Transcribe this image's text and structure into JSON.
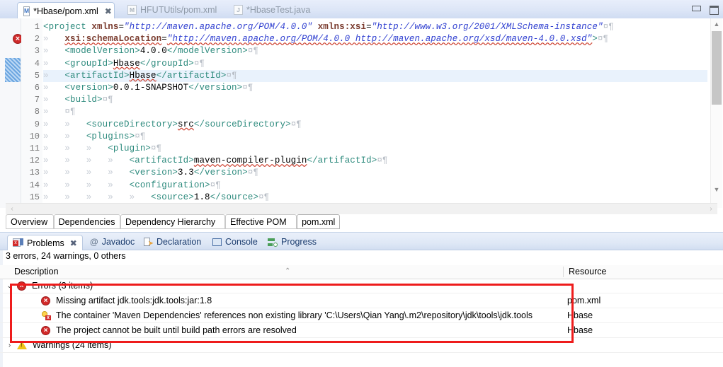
{
  "window": {
    "minimize_label": "Minimize",
    "maximize_label": "Maximize"
  },
  "editor_tabs": [
    {
      "label": "*Hbase/pom.xml",
      "icon": "maven-pom-file-icon",
      "icon_letter": "M",
      "active": true,
      "closeable": true,
      "close_glyph": "✖"
    },
    {
      "label": "HFUTUtils/pom.xml",
      "icon": "maven-pom-file-icon",
      "icon_letter": "M",
      "active": false,
      "closeable": false
    },
    {
      "label": "*HbaseTest.java",
      "icon": "java-file-icon",
      "icon_letter": "J",
      "active": false,
      "closeable": false
    }
  ],
  "code": {
    "lines": [
      {
        "num": "1",
        "fold": true,
        "marker": "",
        "indent_arrows": 0,
        "segs": [
          {
            "t": "<project ",
            "c": "tg"
          },
          {
            "t": "xmlns",
            "c": "at"
          },
          {
            "t": "=",
            "c": "tx"
          },
          {
            "t": "\"http://maven.apache.org/POM/4.0.0\"",
            "c": "vl"
          },
          {
            "t": " ",
            "c": "tx"
          },
          {
            "t": "xmlns:xsi",
            "c": "at"
          },
          {
            "t": "=",
            "c": "tx"
          },
          {
            "t": "\"http://www.w3.org/2001/XMLSchema-instance\"",
            "c": "vl"
          },
          {
            "t": "¤¶",
            "c": "pil"
          }
        ]
      },
      {
        "num": "2",
        "fold": false,
        "marker": "error",
        "indent_arrows": 1,
        "segs": [
          {
            "t": "xsi:schemaLocation",
            "c": "at sqg"
          },
          {
            "t": "=",
            "c": "tx"
          },
          {
            "t": "\"http://maven.apache.org/POM/4.0.0 http://maven.apache.org/xsd/maven-4.0.0.xsd\"",
            "c": "vl sqg"
          },
          {
            "t": ">",
            "c": "tg"
          },
          {
            "t": "¤¶",
            "c": "pil"
          }
        ]
      },
      {
        "num": "3",
        "fold": false,
        "marker": "",
        "indent_arrows": 1,
        "segs": [
          {
            "t": "<modelVersion>",
            "c": "tg"
          },
          {
            "t": "4.0.0",
            "c": "tx"
          },
          {
            "t": "</modelVersion>",
            "c": "tg"
          },
          {
            "t": "¤¶",
            "c": "pil"
          }
        ]
      },
      {
        "num": "4",
        "fold": false,
        "marker": "",
        "indent_arrows": 1,
        "segs": [
          {
            "t": "<groupId>",
            "c": "tg"
          },
          {
            "t": "Hbase",
            "c": "tx sqg"
          },
          {
            "t": "</groupId>",
            "c": "tg"
          },
          {
            "t": "¤¶",
            "c": "pil"
          }
        ]
      },
      {
        "num": "5",
        "fold": false,
        "marker": "selected",
        "indent_arrows": 1,
        "highlight": true,
        "segs": [
          {
            "t": "<artifactId>",
            "c": "tg"
          },
          {
            "t": "Hbase",
            "c": "tx sqg"
          },
          {
            "t": "</artifactId>",
            "c": "tg"
          },
          {
            "t": "¤¶",
            "c": "pil"
          }
        ]
      },
      {
        "num": "6",
        "fold": false,
        "marker": "",
        "indent_arrows": 1,
        "segs": [
          {
            "t": "<version>",
            "c": "tg"
          },
          {
            "t": "0.0.1-SNAPSHOT",
            "c": "tx"
          },
          {
            "t": "</version>",
            "c": "tg"
          },
          {
            "t": "¤¶",
            "c": "pil"
          }
        ]
      },
      {
        "num": "7",
        "fold": true,
        "marker": "",
        "indent_arrows": 1,
        "segs": [
          {
            "t": "<build>",
            "c": "tg"
          },
          {
            "t": "¤¶",
            "c": "pil"
          }
        ]
      },
      {
        "num": "8",
        "fold": false,
        "marker": "",
        "indent_arrows": 1,
        "segs": [
          {
            "t": "¤¶",
            "c": "pil"
          }
        ]
      },
      {
        "num": "9",
        "fold": false,
        "marker": "",
        "indent_arrows": 2,
        "segs": [
          {
            "t": "<sourceDirectory>",
            "c": "tg"
          },
          {
            "t": "src",
            "c": "tx sqg"
          },
          {
            "t": "</sourceDirectory>",
            "c": "tg"
          },
          {
            "t": "¤¶",
            "c": "pil"
          }
        ]
      },
      {
        "num": "10",
        "fold": true,
        "marker": "",
        "indent_arrows": 2,
        "segs": [
          {
            "t": "<plugins>",
            "c": "tg"
          },
          {
            "t": "¤¶",
            "c": "pil"
          }
        ]
      },
      {
        "num": "11",
        "fold": true,
        "marker": "",
        "indent_arrows": 3,
        "segs": [
          {
            "t": "<plugin>",
            "c": "tg"
          },
          {
            "t": "¤¶",
            "c": "pil"
          }
        ]
      },
      {
        "num": "12",
        "fold": false,
        "marker": "",
        "indent_arrows": 4,
        "segs": [
          {
            "t": "<artifactId>",
            "c": "tg"
          },
          {
            "t": "maven-compiler-plugin",
            "c": "tx sqg"
          },
          {
            "t": "</artifactId>",
            "c": "tg"
          },
          {
            "t": "¤¶",
            "c": "pil"
          }
        ]
      },
      {
        "num": "13",
        "fold": false,
        "marker": "",
        "indent_arrows": 4,
        "segs": [
          {
            "t": "<version>",
            "c": "tg"
          },
          {
            "t": "3.3",
            "c": "tx"
          },
          {
            "t": "</version>",
            "c": "tg"
          },
          {
            "t": "¤¶",
            "c": "pil"
          }
        ]
      },
      {
        "num": "14",
        "fold": true,
        "marker": "",
        "indent_arrows": 4,
        "segs": [
          {
            "t": "<configuration>",
            "c": "tg"
          },
          {
            "t": "¤¶",
            "c": "pil"
          }
        ]
      },
      {
        "num": "15",
        "fold": false,
        "marker": "",
        "indent_arrows": 5,
        "segs": [
          {
            "t": "<source>",
            "c": "tg"
          },
          {
            "t": "1.8",
            "c": "tx"
          },
          {
            "t": "</source>",
            "c": "tg"
          },
          {
            "t": "¤¶",
            "c": "pil"
          }
        ]
      }
    ]
  },
  "form_tabs": [
    {
      "label": "Overview",
      "selected": false
    },
    {
      "label": "Dependencies",
      "selected": false
    },
    {
      "label": "Dependency Hierarchy",
      "selected": false
    },
    {
      "label": "Effective POM",
      "selected": false
    },
    {
      "label": "pom.xml",
      "selected": true
    }
  ],
  "view_tabs": [
    {
      "label": "Problems",
      "icon": "problems-icon",
      "active": true,
      "close_glyph": "✖"
    },
    {
      "label": "Javadoc",
      "icon": "javadoc-icon",
      "active": false
    },
    {
      "label": "Declaration",
      "icon": "declaration-icon",
      "active": false
    },
    {
      "label": "Console",
      "icon": "console-icon",
      "active": false
    },
    {
      "label": "Progress",
      "icon": "progress-icon",
      "active": false
    }
  ],
  "problems": {
    "summary": "3 errors, 24 warnings, 0 others",
    "columns": {
      "description": "Description",
      "resource": "Resource"
    },
    "sort_arrow": "⌃",
    "rows": [
      {
        "type": "group",
        "twisty": "⌄",
        "icon": "error-icon",
        "label": "Errors (3 items)",
        "resource": "",
        "indent": 22
      },
      {
        "type": "item",
        "twisty": "",
        "icon": "error-icon",
        "label": "Missing artifact jdk.tools:jdk.tools:jar:1.8",
        "resource": "pom.xml",
        "indent": 56
      },
      {
        "type": "item",
        "twisty": "",
        "icon": "buildpath-warning-icon",
        "label": "The container 'Maven Dependencies' references non existing library 'C:\\Users\\Qian Yang\\.m2\\repository\\jdk\\tools\\jdk.tools",
        "resource": "Hbase",
        "indent": 56
      },
      {
        "type": "item",
        "twisty": "",
        "icon": "error-icon",
        "label": "The project cannot be built until build path errors are resolved",
        "resource": "Hbase",
        "indent": 56
      },
      {
        "type": "group",
        "twisty": "›",
        "icon": "warning-icon",
        "label": "Warnings (24 items)",
        "resource": "",
        "indent": 22
      }
    ]
  },
  "scrollbars": {
    "v_up_glyph": "▲",
    "v_down_glyph": "▼",
    "h_left_glyph": "‹",
    "h_right_glyph": "›"
  },
  "colors": {
    "error_red": "#d22a2a",
    "annotation_red": "#ee1c1c",
    "tag_green": "#2e8b7e",
    "attr_brown": "#7a3b2e",
    "value_blue": "#2f3fd0",
    "tab_blue": "#cfdcf2"
  }
}
